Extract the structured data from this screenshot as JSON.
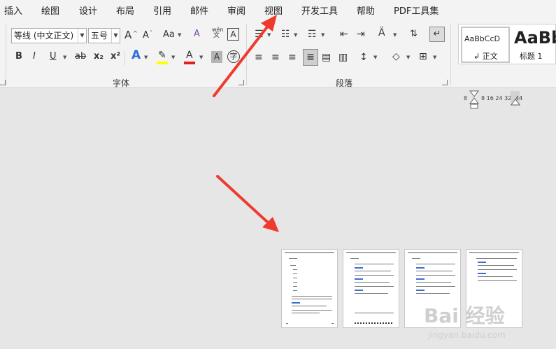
{
  "menu": {
    "tabs": [
      "插入",
      "绘图",
      "设计",
      "布局",
      "引用",
      "邮件",
      "审阅",
      "视图",
      "开发工具",
      "帮助",
      "PDF工具集"
    ]
  },
  "font_group": {
    "font_name": "等线 (中文正文)",
    "font_size": "五号",
    "grow": "A",
    "shrink": "A",
    "case": "Aa",
    "bold": "B",
    "italic": "I",
    "underline": "U",
    "strike": "ab",
    "subscript": "x₂",
    "superscript": "x²",
    "phonetic_top": "wén",
    "phonetic_bottom": "文",
    "border_char": "A",
    "text_effect": "A",
    "font_color": "A",
    "shade_char": "A",
    "enclose_char": "字",
    "label": "字体"
  },
  "paragraph_group": {
    "label": "段落"
  },
  "styles": {
    "normal_preview": "AaBbCcD",
    "normal_label": "↲ 正文",
    "heading_preview": "AaBb",
    "heading_label": "标题 1"
  },
  "ruler": {
    "left": "8",
    "ticks": "8 16 24 32",
    "right": "44"
  },
  "watermark": {
    "brand": "Bai 经验",
    "url": "jingyan.baidu.com"
  },
  "colors": {
    "highlight": "#ffff00",
    "font_color": "#e0201b",
    "arrow": "#ee3b2e",
    "accent_blue": "#3b6fd6"
  }
}
